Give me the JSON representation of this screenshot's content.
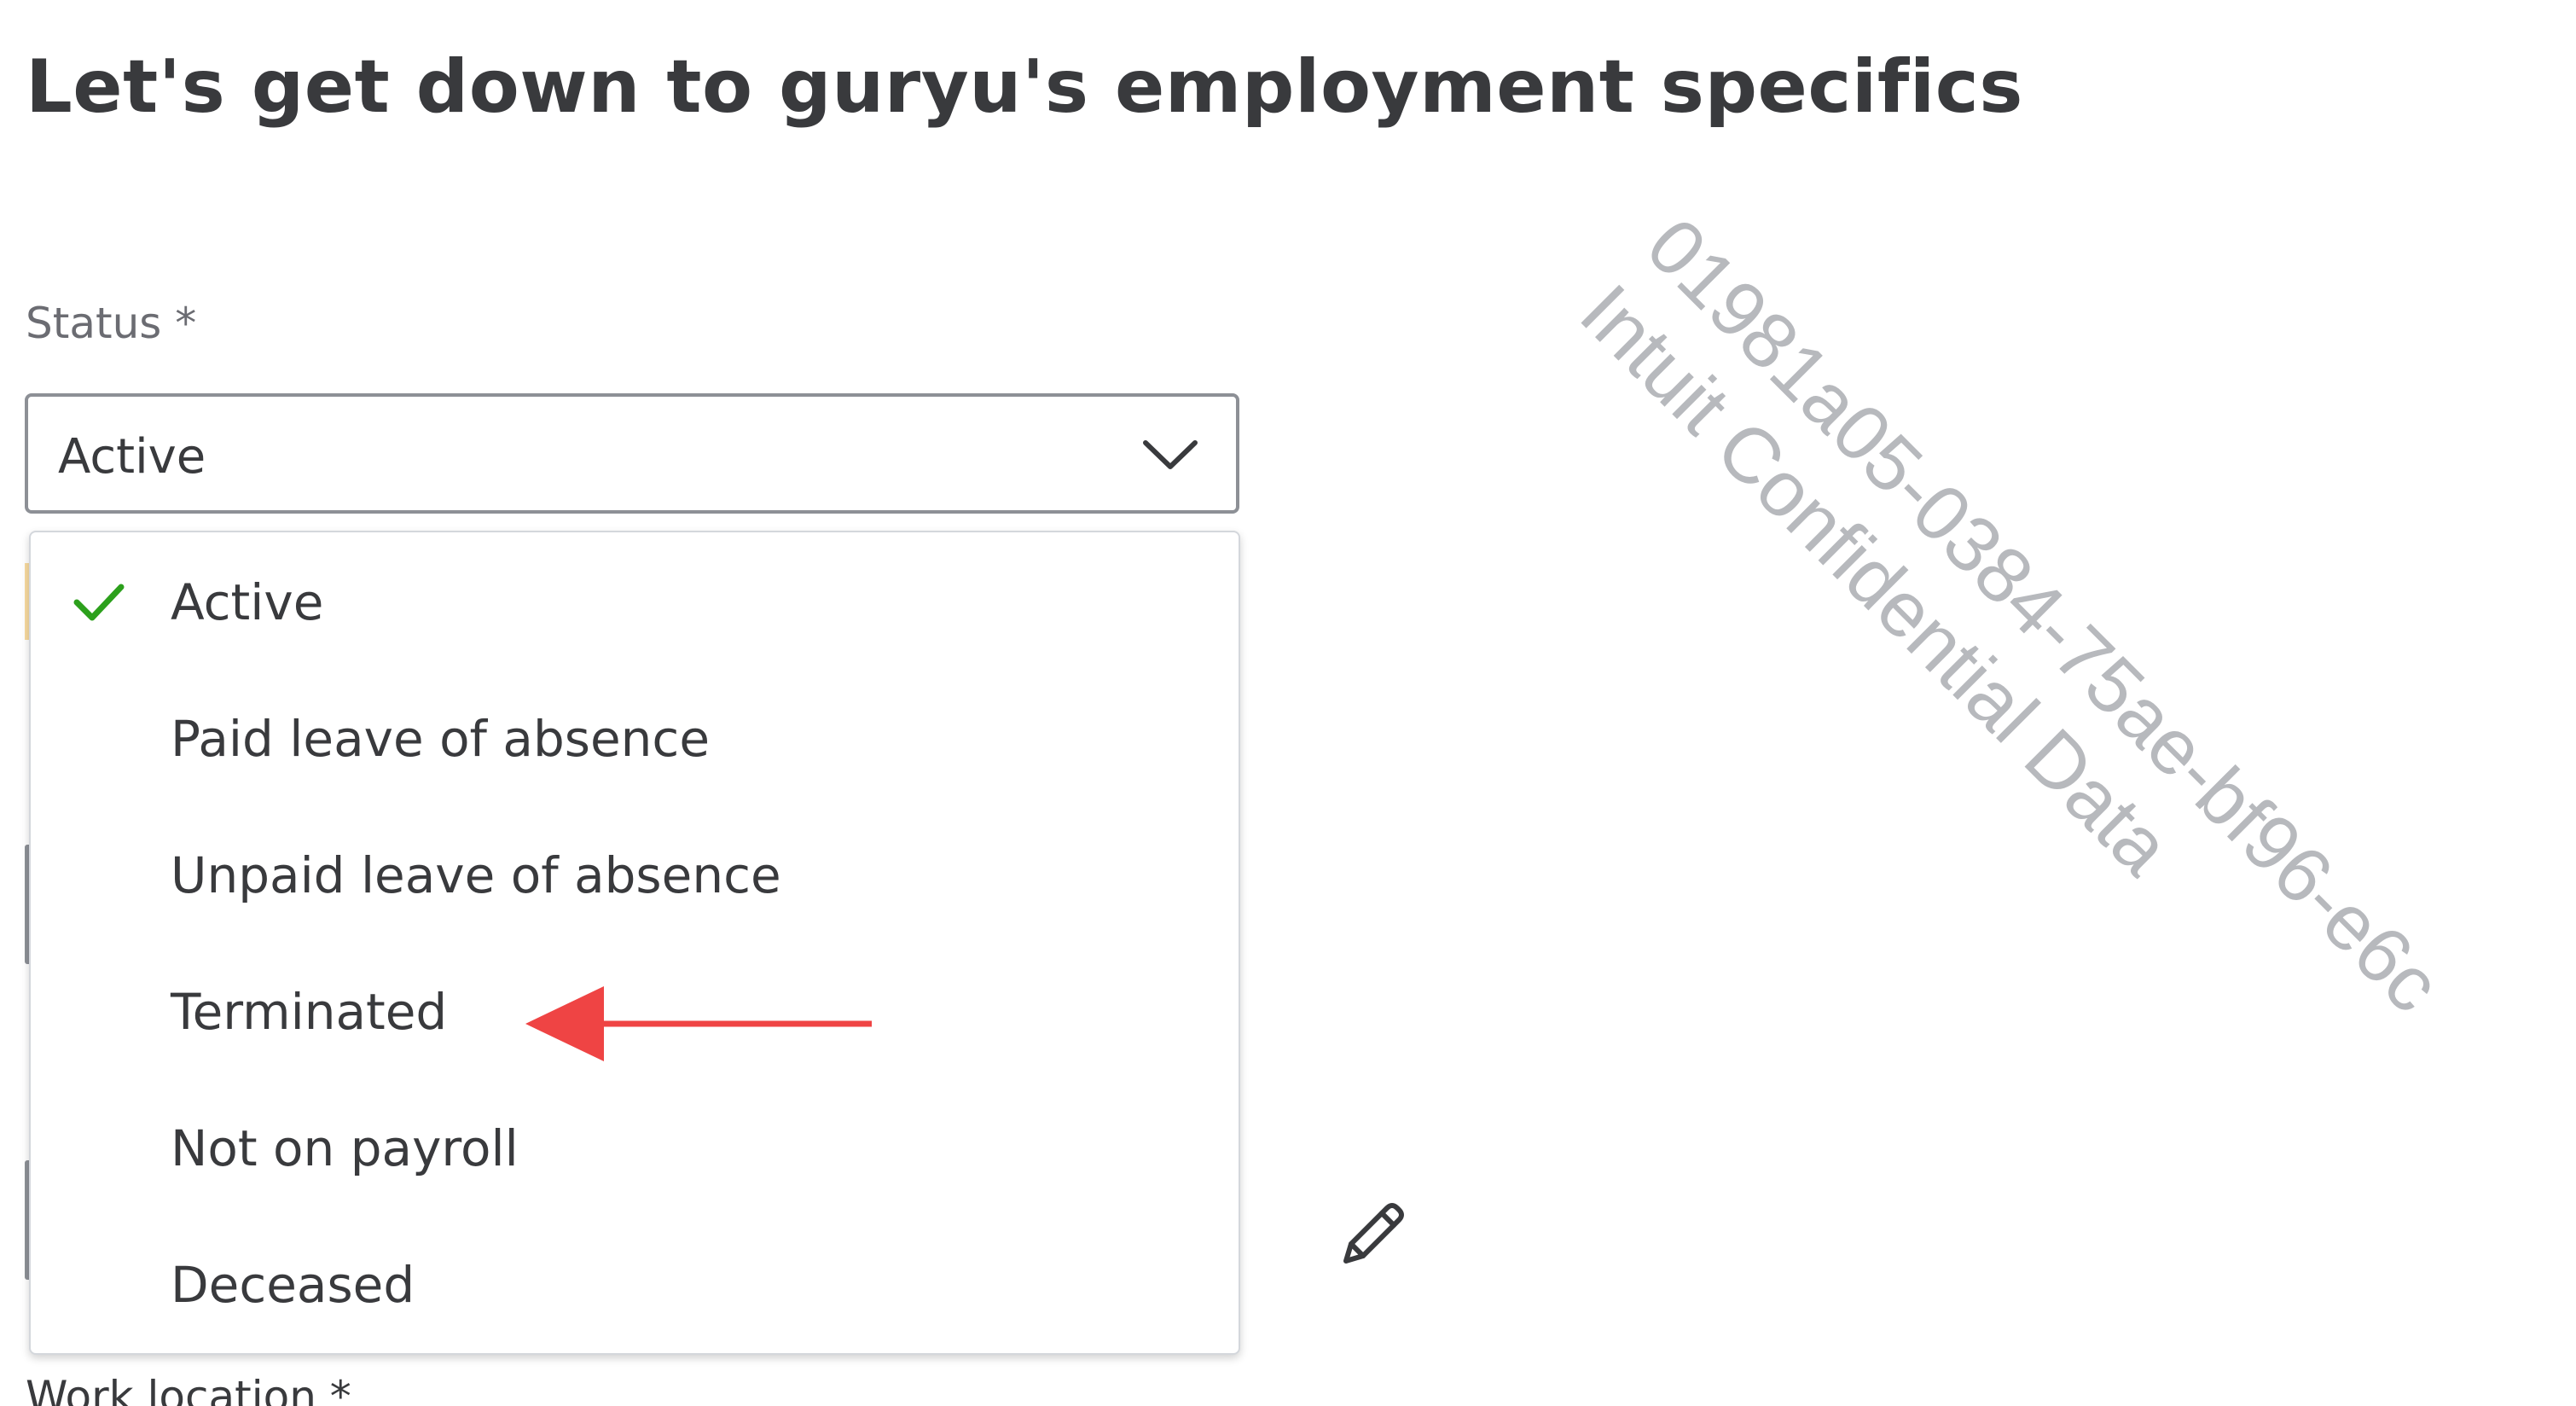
{
  "page": {
    "title": "Let's get down to guryu's employment specifics"
  },
  "status_field": {
    "label": "Status *",
    "selected_value": "Active",
    "options": [
      {
        "label": "Active",
        "selected": true
      },
      {
        "label": "Paid leave of absence",
        "selected": false
      },
      {
        "label": "Unpaid leave of absence",
        "selected": false
      },
      {
        "label": "Terminated",
        "selected": false
      },
      {
        "label": "Not on payroll",
        "selected": false
      },
      {
        "label": "Deceased",
        "selected": false
      }
    ]
  },
  "next_field": {
    "label": "Work location *"
  },
  "watermark": {
    "line1": "01981a05-0384-75ae-bf96-e6c",
    "line2": "Intuit Confidential Data"
  },
  "icons": {
    "chevron": "chevron-down-icon",
    "check": "check-icon",
    "pencil": "pencil-icon",
    "annotation": "arrow-left-annotation"
  },
  "colors": {
    "check": "#2ca01c",
    "annotation_arrow": "#ef4444",
    "text": "#393a3d",
    "label": "#6b6c72",
    "border": "#8d9096"
  }
}
